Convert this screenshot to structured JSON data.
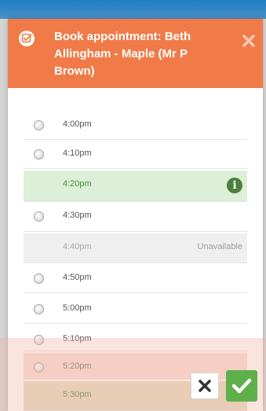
{
  "dialog": {
    "title": "Book appointment: Beth Allingham - Maple (Mr P Brown)",
    "header_icon": "checkbox-icon",
    "close_icon": "close-icon"
  },
  "slots": [
    {
      "time": "4:00pm",
      "state": "available"
    },
    {
      "time": "4:10pm",
      "state": "available"
    },
    {
      "time": "4:20pm",
      "state": "selected",
      "icon": "info-icon",
      "icon_glyph": "i"
    },
    {
      "time": "4:30pm",
      "state": "available"
    },
    {
      "time": "4:40pm",
      "state": "unavailable",
      "status": "Unavailable"
    },
    {
      "time": "4:50pm",
      "state": "available"
    },
    {
      "time": "5:00pm",
      "state": "available"
    },
    {
      "time": "5:10pm",
      "state": "available"
    },
    {
      "time": "5:20pm",
      "state": "conflict"
    },
    {
      "time": "5:30pm",
      "state": "highlighted"
    }
  ],
  "actions": {
    "cancel_icon": "close-icon",
    "confirm_icon": "checkmark-icon"
  },
  "colors": {
    "header": "#f07b48",
    "selected_row": "#dcefd7",
    "confirm_button": "#5fb04a",
    "top_bar": "#1f7fc2"
  }
}
